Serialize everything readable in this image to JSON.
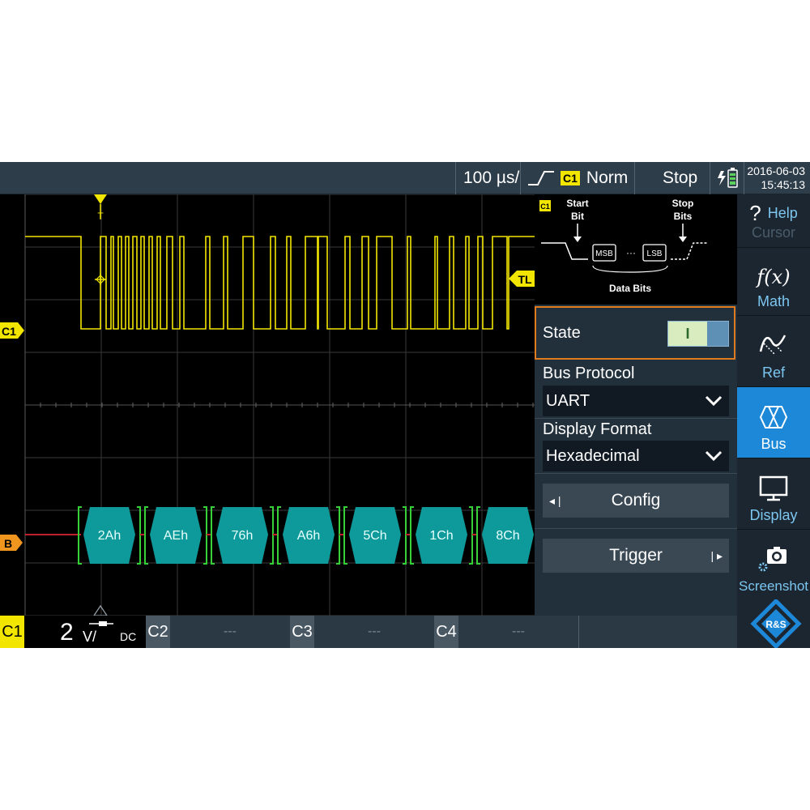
{
  "topbar": {
    "timebase": "100 µs/",
    "trigger_channel": "C1",
    "trigger_mode": "Norm",
    "run_state": "Stop",
    "date": "2016-06-03",
    "time": "15:45:13"
  },
  "waveform": {
    "trigger_marker": "T",
    "trigger_level_marker": "TL",
    "channel_marker": "C1",
    "bus_marker": "B",
    "bus_values": [
      "2Ah",
      "AEh",
      "76h",
      "A6h",
      "5Ch",
      "1Ch",
      "8Ch"
    ],
    "signal_color": "#f2e600",
    "bus_color": "#0e9a9a"
  },
  "panel": {
    "channel_tag": "C1",
    "diagram": {
      "start_bit": [
        "Start",
        "Bit"
      ],
      "stop_bits": [
        "Stop",
        "Bits"
      ],
      "msb": "MSB",
      "lsb": "LSB",
      "data_bits": "Data Bits"
    },
    "state_label": "State",
    "state_toggle": "I",
    "bus_protocol_label": "Bus Protocol",
    "bus_protocol_value": "UART",
    "display_format_label": "Display Format",
    "display_format_value": "Hexadecimal",
    "config_label": "Config",
    "trigger_label": "Trigger"
  },
  "sidebar": {
    "help": "Help",
    "cursor": "Cursor",
    "math": "Math",
    "ref": "Ref",
    "bus": "Bus",
    "display": "Display",
    "screenshot": "Screenshot",
    "math_icon_text": "f(x)",
    "help_icon_text": "?"
  },
  "bottombar": {
    "c1_tag": "C1",
    "c1_scale": "2",
    "c1_unit": "V/",
    "c1_coupling": "DC",
    "c2_tag": "C2",
    "c2_value": "---",
    "c3_tag": "C3",
    "c3_value": "---",
    "c4_tag": "C4",
    "c4_value": "---"
  },
  "brand": {
    "logo_text": "R&S",
    "accent": "#1e88d8",
    "highlight": "#e07b1f"
  }
}
